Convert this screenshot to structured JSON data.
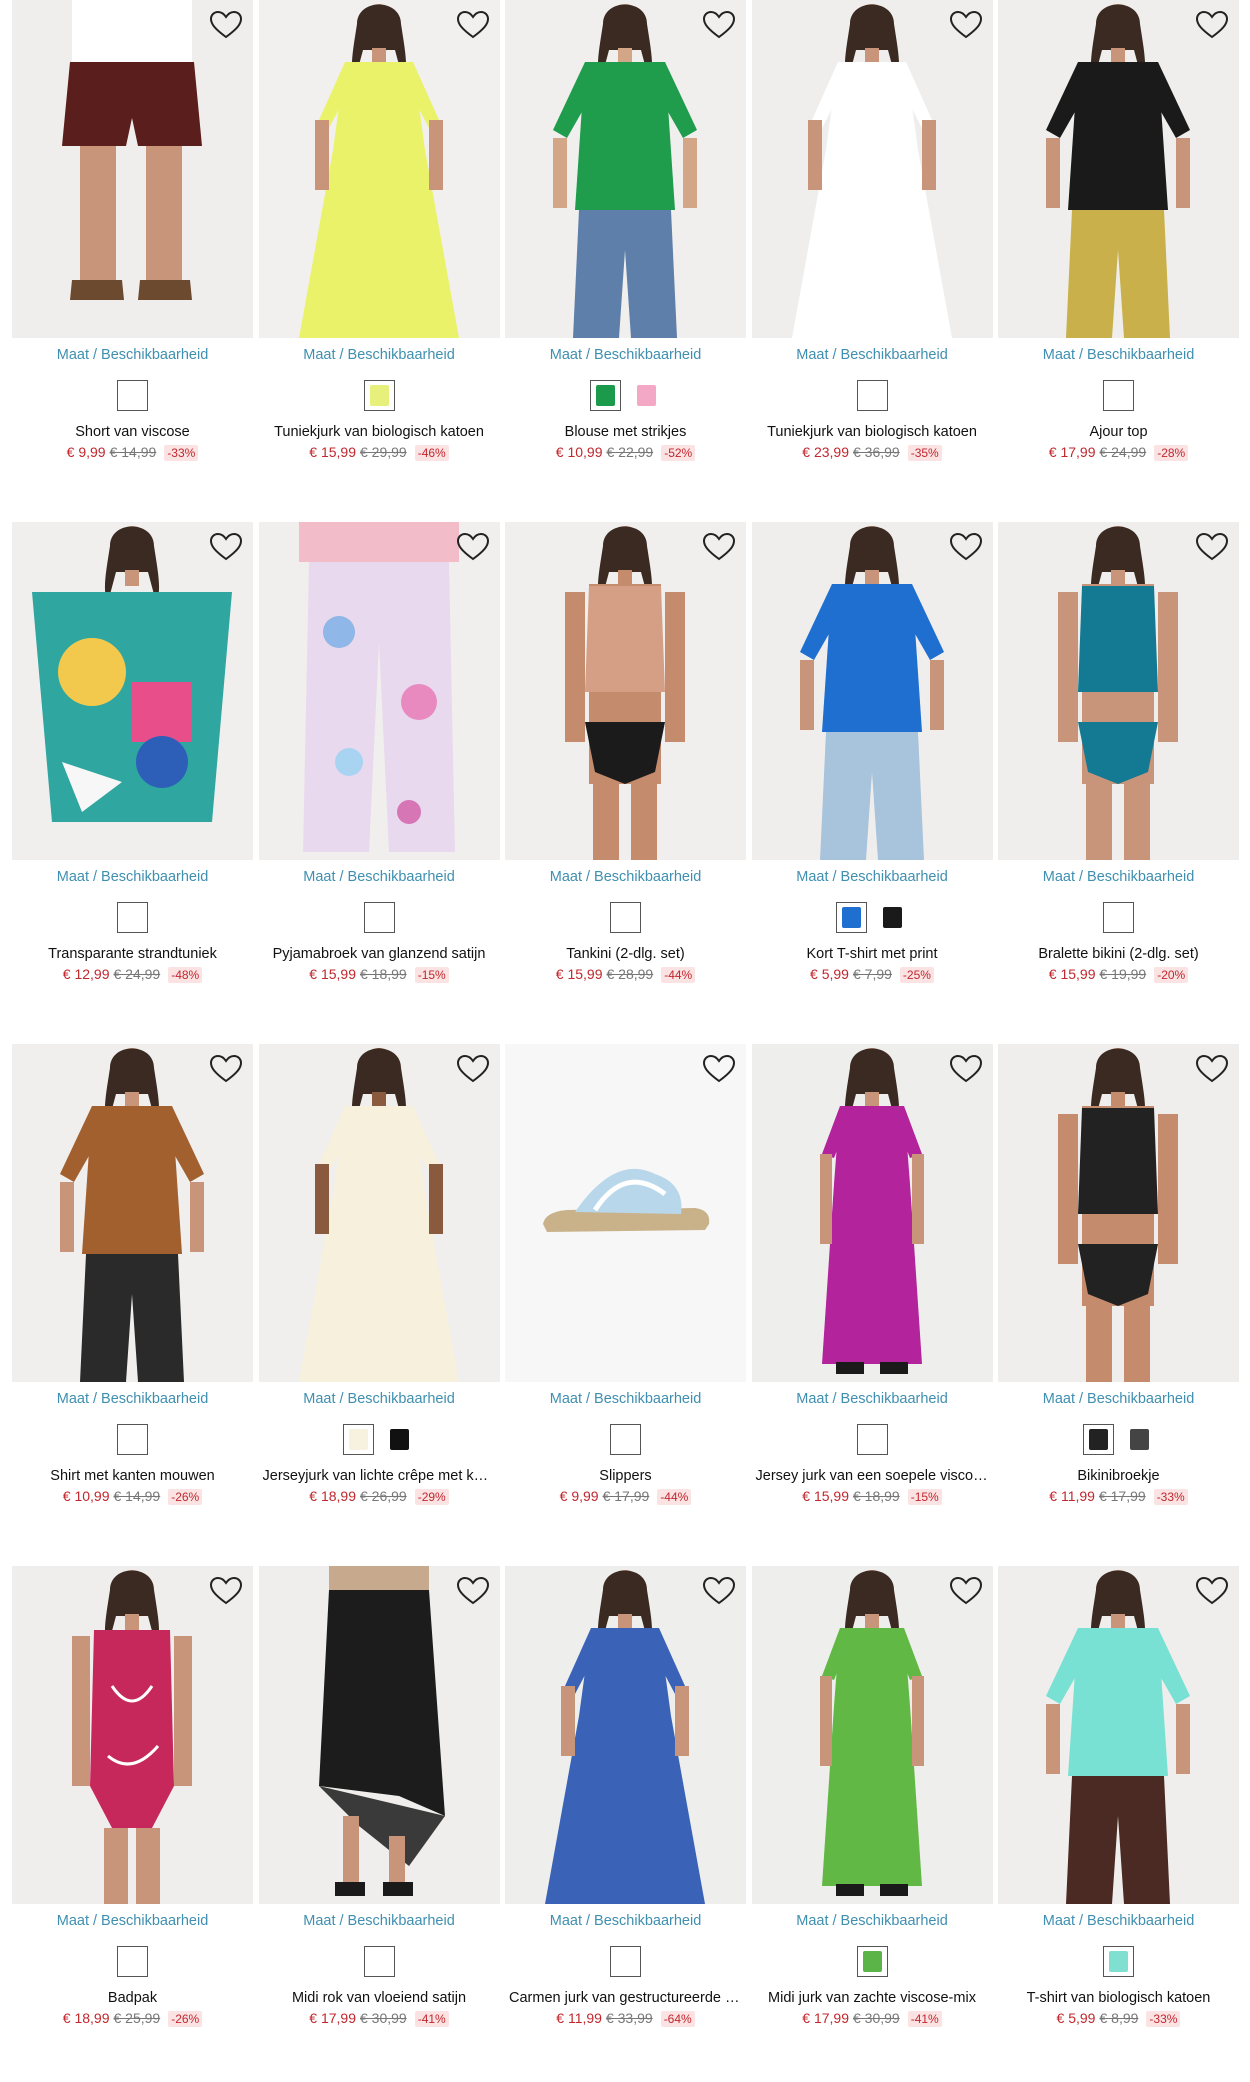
{
  "size_link_label": "Maat / Beschikbaarheid",
  "products": [
    {
      "name": "Short van viscose",
      "price": "€ 9,99",
      "old_price": "€ 14,99",
      "discount": "-33%",
      "swatches": [
        {
          "color": "#ffffff",
          "selected": true
        }
      ],
      "image": {
        "bg": "#f0eeec",
        "top": "#ffffff",
        "bottom": "#5a1f1c",
        "skin": "#c9957a",
        "kind": "shorts"
      }
    },
    {
      "name": "Tuniekjurk van biologisch katoen",
      "price": "€ 15,99",
      "old_price": "€ 29,99",
      "discount": "-46%",
      "swatches": [
        {
          "color": "#e6f07a",
          "selected": true
        }
      ],
      "image": {
        "bg": "#f1f0ee",
        "top": "#eaf26a",
        "bottom": "#eaf26a",
        "skin": "#c9957a",
        "kind": "dress"
      }
    },
    {
      "name": "Blouse met strikjes",
      "price": "€ 10,99",
      "old_price": "€ 22,99",
      "discount": "-52%",
      "swatches": [
        {
          "color": "#1a9a4a",
          "selected": true
        },
        {
          "color": "#f3a9c6",
          "selected": false
        }
      ],
      "image": {
        "bg": "#f0efed",
        "top": "#1f9c4c",
        "bottom": "#5d7fa9",
        "skin": "#d4a688",
        "kind": "top"
      }
    },
    {
      "name": "Tuniekjurk van biologisch katoen",
      "price": "€ 23,99",
      "old_price": "€ 36,99",
      "discount": "-35%",
      "swatches": [
        {
          "color": "#ffffff",
          "selected": true
        }
      ],
      "image": {
        "bg": "#efeeec",
        "top": "#ffffff",
        "bottom": "#f7f7f7",
        "skin": "#c9957a",
        "kind": "dress"
      }
    },
    {
      "name": "Ajour top",
      "price": "€ 17,99",
      "old_price": "€ 24,99",
      "discount": "-28%",
      "swatches": [
        {
          "color": "#ffffff",
          "selected": true
        }
      ],
      "image": {
        "bg": "#efeeec",
        "top": "#1a1a1a",
        "bottom": "#c9b04a",
        "skin": "#c9957a",
        "kind": "top"
      }
    },
    {
      "name": "Transparante strandtuniek",
      "price": "€ 12,99",
      "old_price": "€ 24,99",
      "discount": "-48%",
      "swatches": [
        {
          "color": "#ffffff",
          "selected": true
        }
      ],
      "image": {
        "bg": "#f1efed",
        "top": "#2fa6a0",
        "bottom": "#f2c94c",
        "skin": "#c9957a",
        "kind": "kaftan"
      }
    },
    {
      "name": "Pyjamabroek van glanzend satijn",
      "price": "€ 15,99",
      "old_price": "€ 18,99",
      "discount": "-15%",
      "swatches": [
        {
          "color": "#ffffff",
          "selected": true
        }
      ],
      "image": {
        "bg": "#f0efed",
        "top": "#f3bcc9",
        "bottom": "#e9d9ef",
        "skin": "#c9957a",
        "kind": "pants"
      }
    },
    {
      "name": "Tankini (2-dlg. set)",
      "price": "€ 15,99",
      "old_price": "€ 28,99",
      "discount": "-44%",
      "swatches": [
        {
          "color": "#ffffff",
          "selected": true
        }
      ],
      "image": {
        "bg": "#f0efed",
        "top": "#d59f86",
        "bottom": "#1b1b1b",
        "skin": "#c58b6d",
        "kind": "swim"
      }
    },
    {
      "name": "Kort T-shirt met print",
      "price": "€ 5,99",
      "old_price": "€ 7,99",
      "discount": "-25%",
      "swatches": [
        {
          "color": "#1f6fd1",
          "selected": true
        },
        {
          "color": "#1a1a1a",
          "selected": false
        }
      ],
      "image": {
        "bg": "#efeeec",
        "top": "#1f6fd1",
        "bottom": "#a8c3dc",
        "skin": "#c9957a",
        "kind": "top"
      }
    },
    {
      "name": "Bralette bikini (2-dlg. set)",
      "price": "€ 15,99",
      "old_price": "€ 19,99",
      "discount": "-20%",
      "swatches": [
        {
          "color": "#ffffff",
          "selected": true
        }
      ],
      "image": {
        "bg": "#efeeec",
        "top": "#147a93",
        "bottom": "#147a93",
        "skin": "#c9957a",
        "kind": "swim"
      }
    },
    {
      "name": "Shirt met kanten mouwen",
      "price": "€ 10,99",
      "old_price": "€ 14,99",
      "discount": "-26%",
      "swatches": [
        {
          "color": "#ffffff",
          "selected": true
        }
      ],
      "image": {
        "bg": "#f0efed",
        "top": "#a2602f",
        "bottom": "#2a2a2a",
        "skin": "#c9957a",
        "kind": "top"
      }
    },
    {
      "name": "Jerseyjurk van lichte crêpe met ka…",
      "price": "€ 18,99",
      "old_price": "€ 26,99",
      "discount": "-29%",
      "swatches": [
        {
          "color": "#f7f1e0",
          "selected": true
        },
        {
          "color": "#111111",
          "selected": false
        }
      ],
      "image": {
        "bg": "#f0efed",
        "top": "#f6f0dc",
        "bottom": "#f6f0dc",
        "skin": "#8a5a3f",
        "kind": "dress"
      }
    },
    {
      "name": "Slippers",
      "price": "€ 9,99",
      "old_price": "€ 17,99",
      "discount": "-44%",
      "swatches": [
        {
          "color": "#ffffff",
          "selected": true
        }
      ],
      "image": {
        "bg": "#f7f7f7",
        "top": "#b9d7ea",
        "bottom": "#c9b28a",
        "skin": "#c9957a",
        "kind": "shoe"
      }
    },
    {
      "name": "Jersey jurk van een soepele viscose…",
      "price": "€ 15,99",
      "old_price": "€ 18,99",
      "discount": "-15%",
      "swatches": [
        {
          "color": "#ffffff",
          "selected": true
        }
      ],
      "image": {
        "bg": "#eeeeec",
        "top": "#b3239b",
        "bottom": "#b3239b",
        "skin": "#c9957a",
        "kind": "maxi"
      }
    },
    {
      "name": "Bikinibroekje",
      "price": "€ 11,99",
      "old_price": "€ 17,99",
      "discount": "-33%",
      "swatches": [
        {
          "color": "#222222",
          "selected": true
        },
        {
          "color": "#444444",
          "selected": false
        }
      ],
      "image": {
        "bg": "#efeeec",
        "top": "#222222",
        "bottom": "#ececec",
        "skin": "#c58b6d",
        "kind": "swim"
      }
    },
    {
      "name": "Badpak",
      "price": "€ 18,99",
      "old_price": "€ 25,99",
      "discount": "-26%",
      "swatches": [
        {
          "color": "#ffffff",
          "selected": true
        }
      ],
      "image": {
        "bg": "#efeeec",
        "top": "#c7285b",
        "bottom": "#c7285b",
        "skin": "#c9957a",
        "kind": "swimsuit"
      }
    },
    {
      "name": "Midi rok van vloeiend satijn",
      "price": "€ 17,99",
      "old_price": "€ 30,99",
      "discount": "-41%",
      "swatches": [
        {
          "color": "#ffffff",
          "selected": true
        }
      ],
      "image": {
        "bg": "#efeeec",
        "top": "#c7a98e",
        "bottom": "#1c1c1c",
        "skin": "#c9957a",
        "kind": "skirt"
      }
    },
    {
      "name": "Carmen jurk van gestructureerde v…",
      "price": "€ 11,99",
      "old_price": "€ 33,99",
      "discount": "-64%",
      "swatches": [
        {
          "color": "#ffffff",
          "selected": true
        }
      ],
      "image": {
        "bg": "#eeeeec",
        "top": "#3a63b8",
        "bottom": "#dfe7f5",
        "skin": "#c9957a",
        "kind": "dress"
      }
    },
    {
      "name": "Midi jurk van zachte viscose-mix",
      "price": "€ 17,99",
      "old_price": "€ 30,99",
      "discount": "-41%",
      "swatches": [
        {
          "color": "#5bb447",
          "selected": true
        }
      ],
      "image": {
        "bg": "#eeeeec",
        "top": "#62b845",
        "bottom": "#62b845",
        "skin": "#c9957a",
        "kind": "maxi"
      }
    },
    {
      "name": "T-shirt van biologisch katoen",
      "price": "€ 5,99",
      "old_price": "€ 8,99",
      "discount": "-33%",
      "swatches": [
        {
          "color": "#7fe0d2",
          "selected": true
        }
      ],
      "image": {
        "bg": "#efeeec",
        "top": "#79e1d3",
        "bottom": "#4a2a22",
        "skin": "#c9957a",
        "kind": "top"
      }
    }
  ]
}
